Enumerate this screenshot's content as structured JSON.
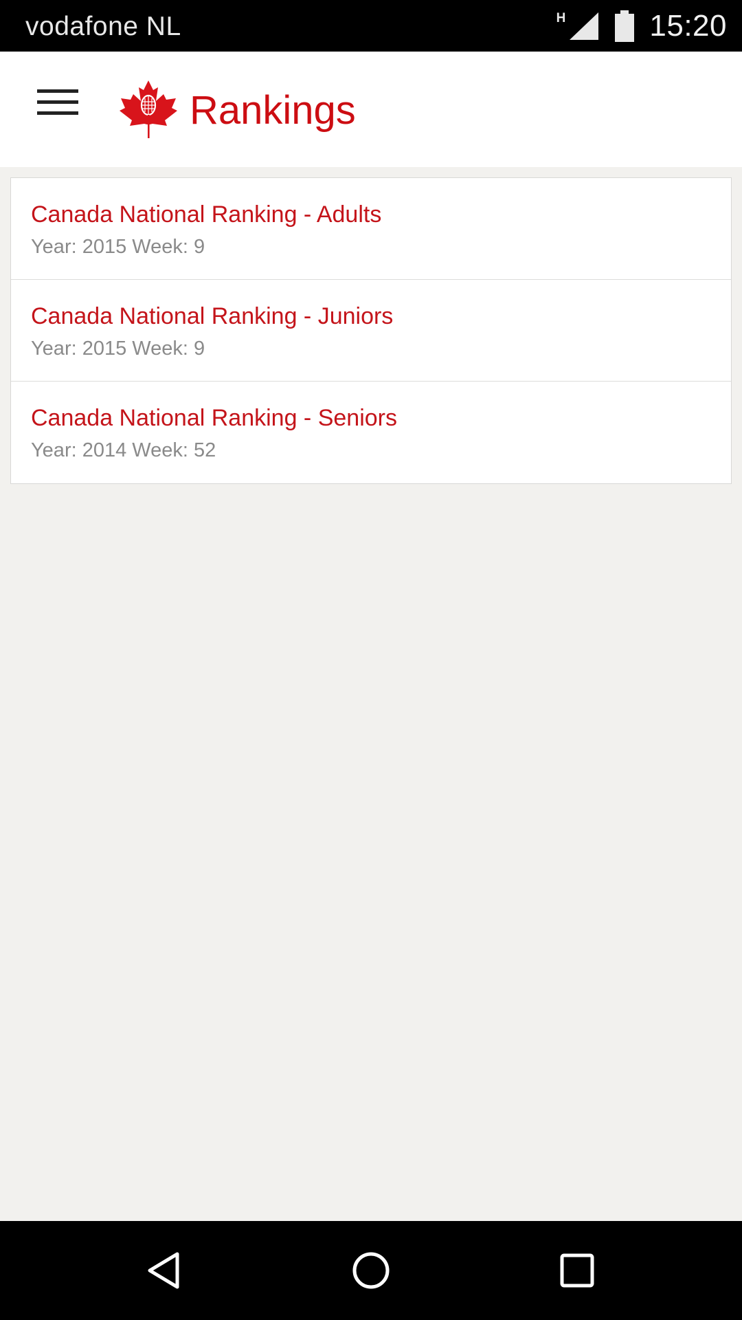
{
  "status_bar": {
    "carrier": "vodafone NL",
    "network_type": "H",
    "time": "15:20",
    "icons": [
      "signal-icon",
      "battery-icon"
    ]
  },
  "app_bar": {
    "title": "Rankings",
    "menu_icon": "hamburger-menu-icon",
    "logo_icon": "maple-leaf-racket-logo"
  },
  "colors": {
    "accent": "#cc0d12",
    "subtitle": "#8a8a8a",
    "background": "#f2f1ee",
    "bars": "#000000"
  },
  "rankings": [
    {
      "title": "Canada National Ranking - Adults",
      "subtitle": "Year: 2015 Week: 9"
    },
    {
      "title": "Canada National Ranking - Juniors",
      "subtitle": "Year: 2015 Week: 9"
    },
    {
      "title": "Canada National Ranking - Seniors",
      "subtitle": "Year: 2014 Week: 52"
    }
  ],
  "nav_bar": {
    "icons": [
      "back-icon",
      "home-icon",
      "recent-apps-icon"
    ]
  }
}
